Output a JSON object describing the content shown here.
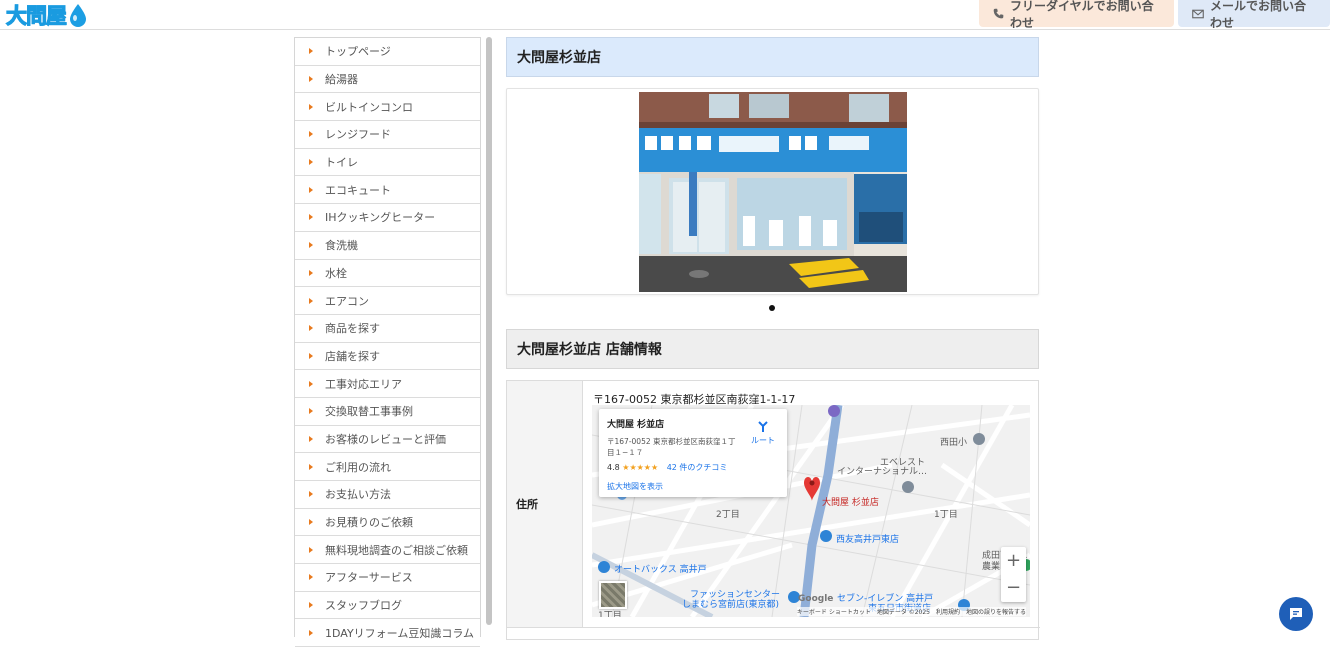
{
  "header": {
    "logo_text": "大問屋",
    "tel_label": "フリーダイヤルでお問い合わせ",
    "mail_label": "メールでお問い合わせ"
  },
  "sidebar": {
    "items": [
      {
        "label": "トップページ"
      },
      {
        "label": "給湯器"
      },
      {
        "label": "ビルトインコンロ"
      },
      {
        "label": "レンジフード"
      },
      {
        "label": "トイレ"
      },
      {
        "label": "エコキュート"
      },
      {
        "label": "IHクッキングヒーター"
      },
      {
        "label": "食洗機"
      },
      {
        "label": "水栓"
      },
      {
        "label": "エアコン"
      },
      {
        "label": "商品を探す"
      },
      {
        "label": "店舗を探す"
      },
      {
        "label": "工事対応エリア"
      },
      {
        "label": "交換取替工事事例"
      },
      {
        "label": "お客様のレビューと評価"
      },
      {
        "label": "ご利用の流れ"
      },
      {
        "label": "お支払い方法"
      },
      {
        "label": "お見積りのご依頼"
      },
      {
        "label": "無料現地調査のご相談ご依頼"
      },
      {
        "label": "アフターサービス"
      },
      {
        "label": "スタッフブログ"
      },
      {
        "label": "1DAYリフォーム豆知識コラム"
      }
    ]
  },
  "main": {
    "store_title": "大問屋杉並店",
    "info_title": "大問屋杉並店 店舗情報",
    "address_label": "住所",
    "address_value": "〒167-0052 東京都杉並区南荻窪1-1-17"
  },
  "map": {
    "card_title": "大問屋 杉並店",
    "card_address": "〒167-0052 東京都杉並区南荻窪１丁目１−１７",
    "rating": "4.8",
    "stars": "★★★★★",
    "reviews": "42 件のクチコミ",
    "enlarge_link": "拡大地図を表示",
    "route_label": "ルート",
    "pin_label": "大問屋 杉並店",
    "labels": {
      "everest": "エベレスト",
      "international": "インターナショナル…",
      "nishida": "西田小",
      "chome2": "2丁目",
      "chome1": "1丁目",
      "chome1b": "1丁目",
      "seiyu": "西友高井戸東店",
      "autobacs": "オートバックス 高井戸",
      "fashion": "ファッションセンター",
      "shimamura": "しまむら宮前店(東京都)",
      "seven": "セブン-イレブン 高井戸",
      "seven2": "東五日市街道店",
      "seijo": "成田西ふれ",
      "farm": "農業"
    },
    "footer": "キーボード ショートカット　地図データ ©2025　利用規約　地図の誤りを報告する",
    "google": "Google",
    "zoom_in": "+",
    "zoom_out": "−"
  }
}
